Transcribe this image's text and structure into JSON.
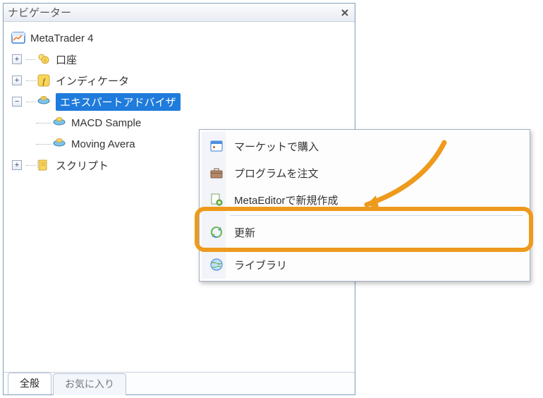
{
  "panel": {
    "title": "ナビゲーター",
    "close_tooltip": "x"
  },
  "tree": {
    "root": {
      "label": "MetaTrader 4"
    },
    "accounts": {
      "label": "口座",
      "expander": "+"
    },
    "indicators": {
      "label": "インディケータ",
      "expander": "+"
    },
    "experts": {
      "label": "エキスパートアドバイザ",
      "expander": "−"
    },
    "expert_children": [
      {
        "label": "MACD Sample"
      },
      {
        "label": "Moving Avera"
      }
    ],
    "scripts": {
      "label": "スクリプト",
      "expander": "+"
    }
  },
  "tabs": {
    "general": "全般",
    "favorites": "お気に入り"
  },
  "context_menu": {
    "buy_market": "マーケットで購入",
    "order_program": "プログラムを注文",
    "metaeditor": "MetaEditorで新規作成",
    "refresh": "更新",
    "library": "ライブラリ"
  }
}
